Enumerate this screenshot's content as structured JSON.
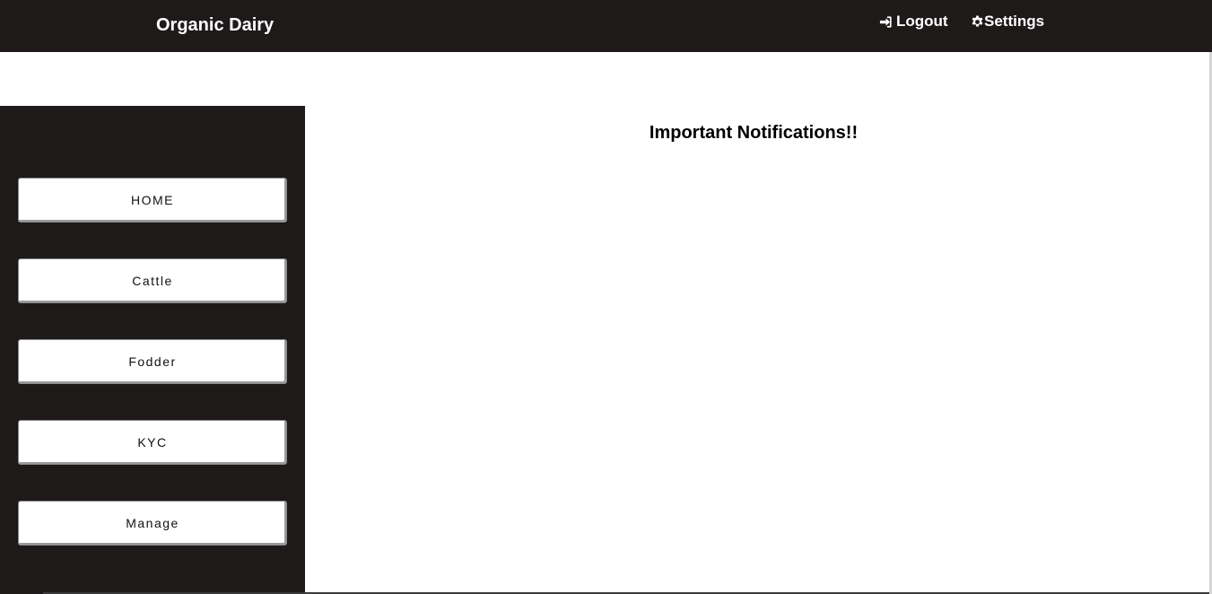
{
  "header": {
    "brand": "Organic Dairy",
    "logout_label": "Logout",
    "settings_label": "Settings",
    "logout_icon": "sign-in-icon",
    "settings_icon": "gear-icon"
  },
  "sidebar": {
    "items": [
      {
        "label": "HOME"
      },
      {
        "label": "Cattle"
      },
      {
        "label": "Fodder"
      },
      {
        "label": "KYC"
      },
      {
        "label": "Manage"
      }
    ]
  },
  "main": {
    "heading": "Important Notifications!!"
  },
  "colors": {
    "nav_background": "#1e1a1a",
    "button_background": "#ffffff",
    "text_light": "#ffffff"
  }
}
